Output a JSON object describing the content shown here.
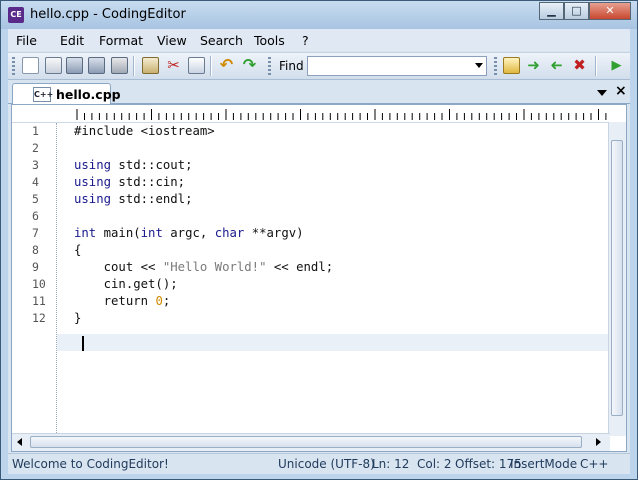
{
  "window": {
    "title": "hello.cpp - CodingEditor",
    "app_icon_text": "CE",
    "minimize_glyph": "▁",
    "maximize_glyph": "□",
    "close_glyph": "✕"
  },
  "menu": [
    "File",
    "Edit",
    "Format",
    "View",
    "Search",
    "Tools",
    "?"
  ],
  "toolbar": {
    "find_label": "Find",
    "find_value": "",
    "icons": [
      "new-file-icon",
      "open-file-icon",
      "save-icon",
      "save-all-icon",
      "print-icon",
      "copy-icon",
      "cut-icon",
      "paste-icon",
      "undo-icon",
      "redo-icon"
    ],
    "find_icons": [
      "find-icon",
      "find-next-icon",
      "find-previous-icon",
      "replace-icon",
      "run-icon"
    ]
  },
  "tab": {
    "label": "hello.cpp",
    "icon_text": "C++",
    "close_glyph": "×"
  },
  "editor": {
    "line_numbers": [
      "1",
      "2",
      "3",
      "4",
      "5",
      "6",
      "7",
      "8",
      "9",
      "10",
      "11",
      "12"
    ],
    "lines": [
      "#include <iostream>",
      "",
      "using std::cout;",
      "using std::cin;",
      "using std::endl;",
      "",
      "int main(int argc, char **argv)",
      "{",
      "    cout << \"Hello World!\" << endl;",
      "    cin.get();",
      "    return 0;",
      "}"
    ],
    "current_line": 12
  },
  "status": {
    "message": "Welcome to CodingEditor!",
    "encoding": "Unicode (UTF-8)",
    "line": "Ln: 12",
    "column": "Col: 2",
    "offset": "Offset: 175",
    "mode": "InsertMode",
    "language": "C++"
  },
  "colors": {
    "keyword": "#1a1a8c",
    "string": "#7a7a7a",
    "number": "#d08a00",
    "status_text": "#1f3a5a"
  }
}
